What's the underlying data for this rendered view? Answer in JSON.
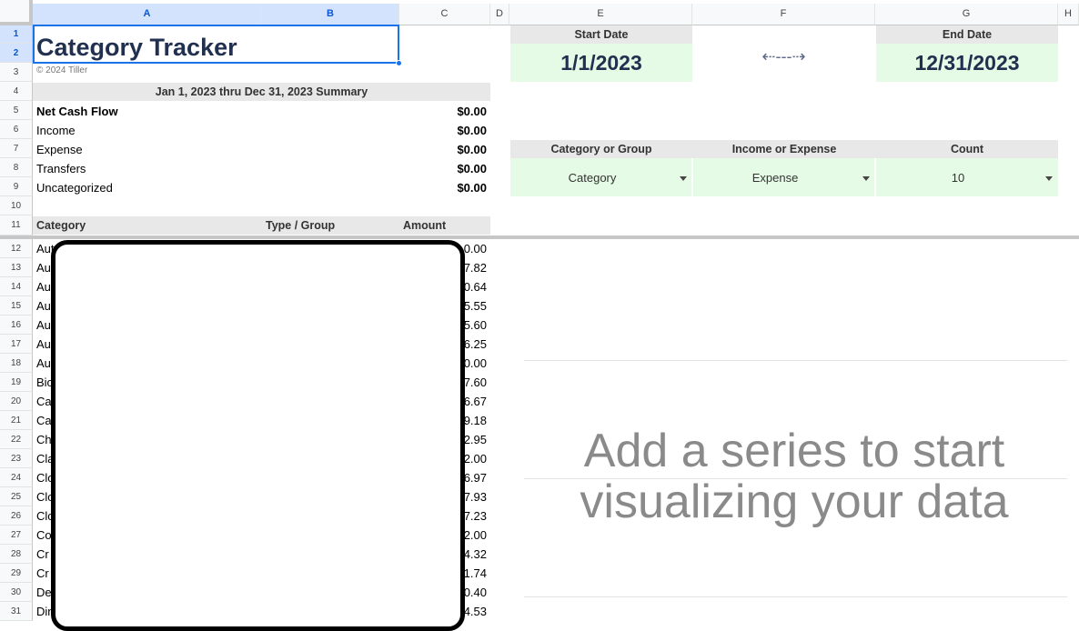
{
  "columns": [
    "A",
    "B",
    "C",
    "D",
    "E",
    "F",
    "G",
    "H"
  ],
  "rows": [
    "1",
    "2",
    "3",
    "4",
    "5",
    "6",
    "7",
    "8",
    "9",
    "10",
    "11",
    "12",
    "13",
    "14",
    "15",
    "16",
    "17",
    "18",
    "19",
    "20",
    "21",
    "22",
    "23",
    "24",
    "25",
    "26",
    "27",
    "28",
    "29",
    "30",
    "31"
  ],
  "title": "Category Tracker",
  "copyright": "© 2024 Tiller",
  "summary": {
    "header": "Jan 1, 2023 thru Dec 31, 2023 Summary",
    "items": [
      {
        "label": "Net Cash Flow",
        "value": "$0.00"
      },
      {
        "label": "Income",
        "value": "$0.00"
      },
      {
        "label": "Expense",
        "value": "$0.00"
      },
      {
        "label": "Transfers",
        "value": "$0.00"
      },
      {
        "label": "Uncategorized",
        "value": "$0.00"
      }
    ]
  },
  "table_header": {
    "category": "Category",
    "type_group": "Type / Group",
    "amount": "Amount"
  },
  "table_rows": [
    {
      "cat": "Aut",
      "amt": "0.00"
    },
    {
      "cat": "Au",
      "amt": "7.82"
    },
    {
      "cat": "Au",
      "amt": "0.64"
    },
    {
      "cat": "Au",
      "amt": "5.55"
    },
    {
      "cat": "Au",
      "amt": "5.60"
    },
    {
      "cat": "Au",
      "amt": "6.25"
    },
    {
      "cat": "Au",
      "amt": "0.00"
    },
    {
      "cat": "Bio",
      "amt": "7.60"
    },
    {
      "cat": "Ca",
      "amt": "6.67"
    },
    {
      "cat": "Ca",
      "amt": "9.18"
    },
    {
      "cat": "Ch",
      "amt": "2.95"
    },
    {
      "cat": "Cla",
      "amt": "2.00"
    },
    {
      "cat": "Clo",
      "amt": "6.97"
    },
    {
      "cat": "Clo",
      "amt": "7.93"
    },
    {
      "cat": "Clo",
      "amt": "7.23"
    },
    {
      "cat": "Co",
      "amt": "2.00"
    },
    {
      "cat": "Cr",
      "amt": "4.32"
    },
    {
      "cat": "Cr",
      "amt": "11.74"
    },
    {
      "cat": "De",
      "amt": "0.40"
    },
    {
      "cat": "Din",
      "amt": "4.53"
    }
  ],
  "start_date": {
    "label": "Start Date",
    "value": "1/1/2023"
  },
  "end_date": {
    "label": "End Date",
    "value": "12/31/2023"
  },
  "arrow": "⇠---⇢",
  "controls": {
    "category_or_group": {
      "label": "Category or Group",
      "value": "Category"
    },
    "income_or_expense": {
      "label": "Income or Expense",
      "value": "Expense"
    },
    "count": {
      "label": "Count",
      "value": "10"
    }
  },
  "chart_placeholder": {
    "line1": "Add a series to start",
    "line2": "visualizing your data"
  },
  "colors": {
    "accent": "#0b57d0",
    "title": "#22304f",
    "green_fill": "#e6fbe6",
    "band": "#e8e8e8"
  }
}
